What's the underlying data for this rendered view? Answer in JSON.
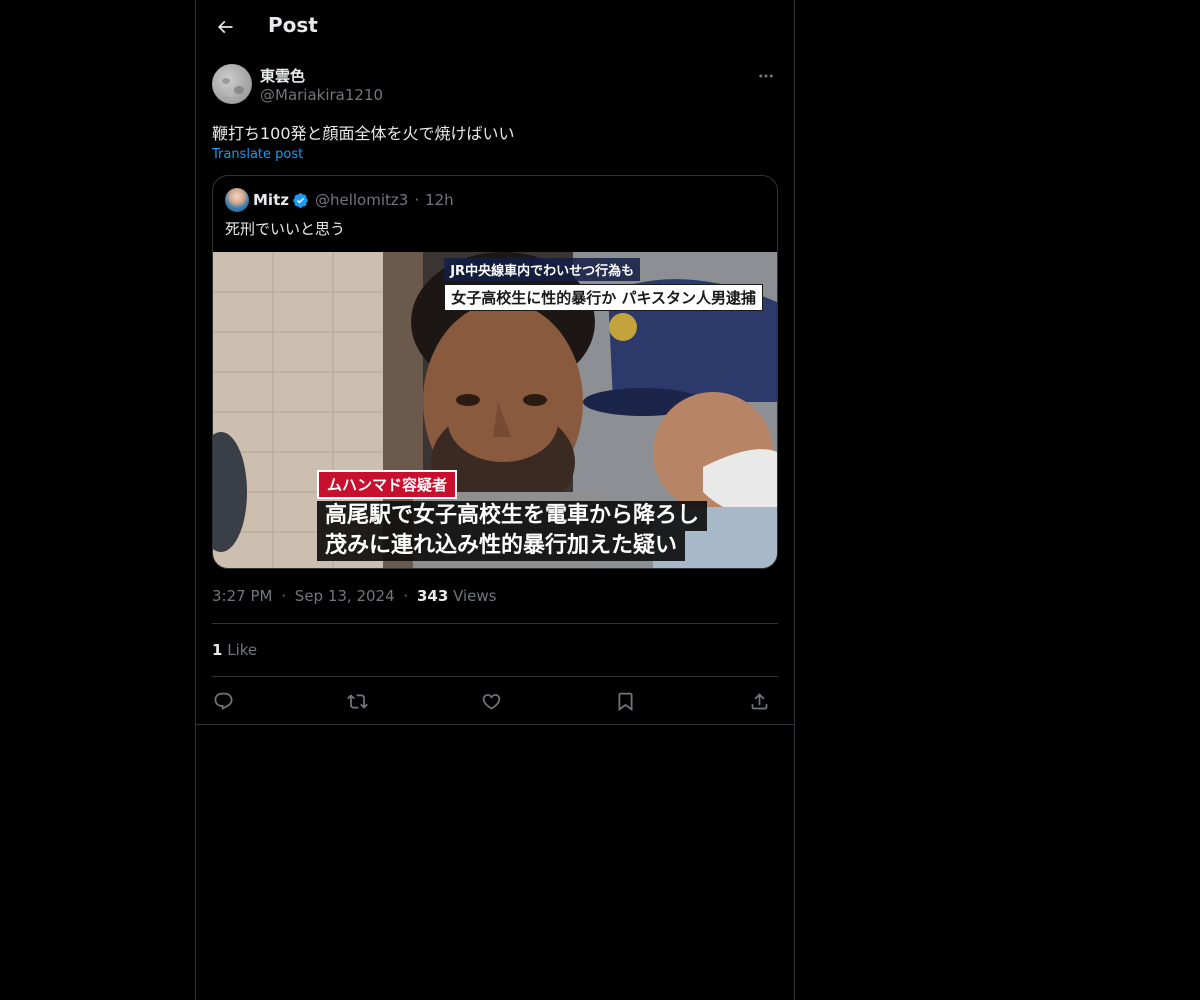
{
  "header": {
    "title": "Post",
    "back_icon": "arrow-left-icon"
  },
  "post": {
    "author": {
      "display_name": "東雲色",
      "handle": "@Mariakira1210"
    },
    "text": "鞭打ち100発と顔面全体を火で焼けばいい",
    "translate_label": "Translate post",
    "timestamp": {
      "time": "3:27 PM",
      "date": "Sep 13, 2024",
      "views_count": "343",
      "views_label": "Views",
      "separator": "·"
    },
    "likes": {
      "count": "1",
      "label": "Like"
    }
  },
  "quoted_post": {
    "author": {
      "display_name": "Mitz",
      "handle": "@hellomitz3",
      "verified": true
    },
    "age": "12h",
    "separator": "·",
    "text": "死刑でいいと思う",
    "media": {
      "caption_top_line1": "JR中央線車内でわいせつ行為も",
      "caption_top_line2": "女子高校生に性的暴行か パキスタン人男逮捕",
      "caption_label": "ムハンマド容疑者",
      "caption_line1": "高尾駅で女子高校生を電車から降ろし",
      "caption_line2": "茂みに連れ込み性的暴行加えた疑い"
    }
  },
  "actions": {
    "reply_icon": "reply-icon",
    "repost_icon": "repost-icon",
    "like_icon": "heart-icon",
    "bookmark_icon": "bookmark-icon",
    "share_icon": "share-icon"
  },
  "colors": {
    "background": "#000000",
    "text_primary": "#e7e9ea",
    "text_secondary": "#71767b",
    "link": "#1d9bf0",
    "border": "#2f3336",
    "verified": "#1d9bf0"
  }
}
